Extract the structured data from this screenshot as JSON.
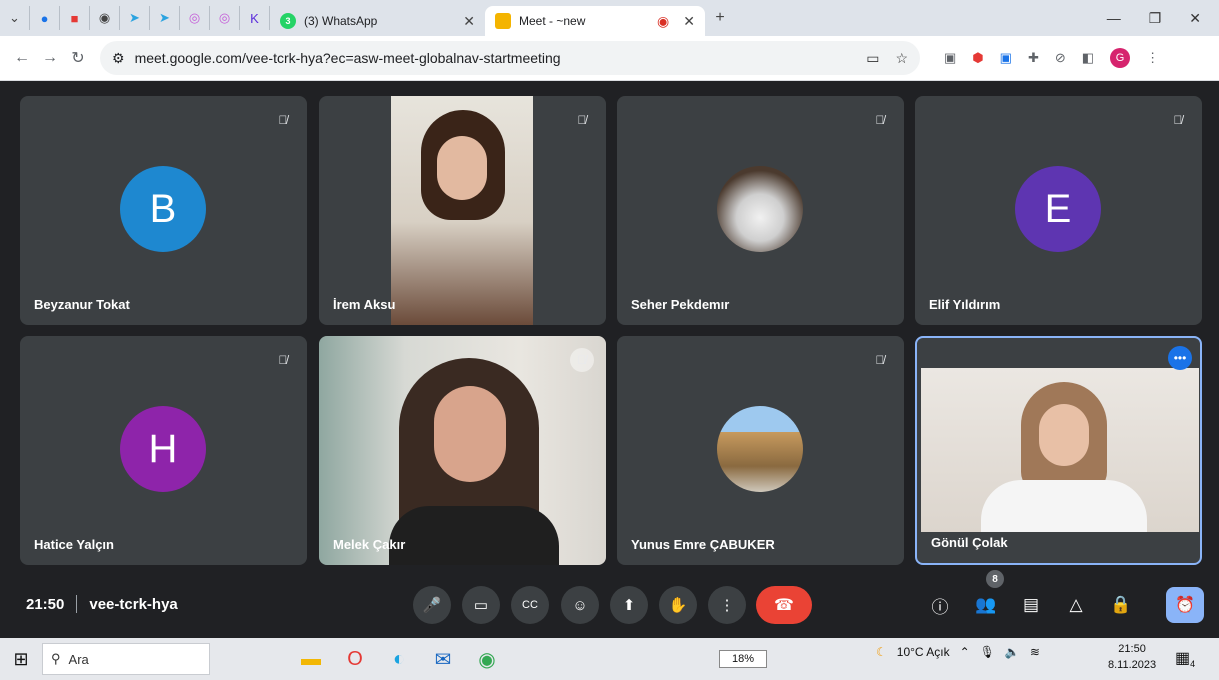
{
  "browser": {
    "tabs": [
      {
        "label": "(3) WhatsApp",
        "active": false
      },
      {
        "label": "Meet - ~new",
        "active": true
      }
    ],
    "url": "meet.google.com/vee-tcrk-hya?ec=asw-meet-globalnav-startmeeting",
    "profile_initial": "G"
  },
  "meet": {
    "participants": [
      {
        "name": "Beyzanur Tokat",
        "initial": "B",
        "color": "#1e88d0",
        "muted": true
      },
      {
        "name": "İrem Aksu",
        "muted": true
      },
      {
        "name": "Seher Pekdemır",
        "muted": true
      },
      {
        "name": "Elif Yıldırım",
        "initial": "E",
        "color": "#5e35b1",
        "muted": true
      },
      {
        "name": "Hatice Yalçın",
        "initial": "H",
        "color": "#8e24aa",
        "muted": true
      },
      {
        "name": "Melek Çakır",
        "muted": true
      },
      {
        "name": "Yunus Emre ÇABUKER",
        "muted": true
      },
      {
        "name": "Gönül Çolak",
        "muted": false
      }
    ],
    "time": "21:50",
    "meeting_code": "vee-tcrk-hya",
    "people_count": "8"
  },
  "taskbar": {
    "search_placeholder": "Ara",
    "battery": "18%",
    "weather": "10°C Açık",
    "clock_time": "21:50",
    "clock_date": "8.11.2023",
    "notification_count": "4"
  },
  "colors": {
    "accent": "#8ab4f8",
    "end_call": "#ea4335",
    "tile_bg": "#3c4043"
  }
}
